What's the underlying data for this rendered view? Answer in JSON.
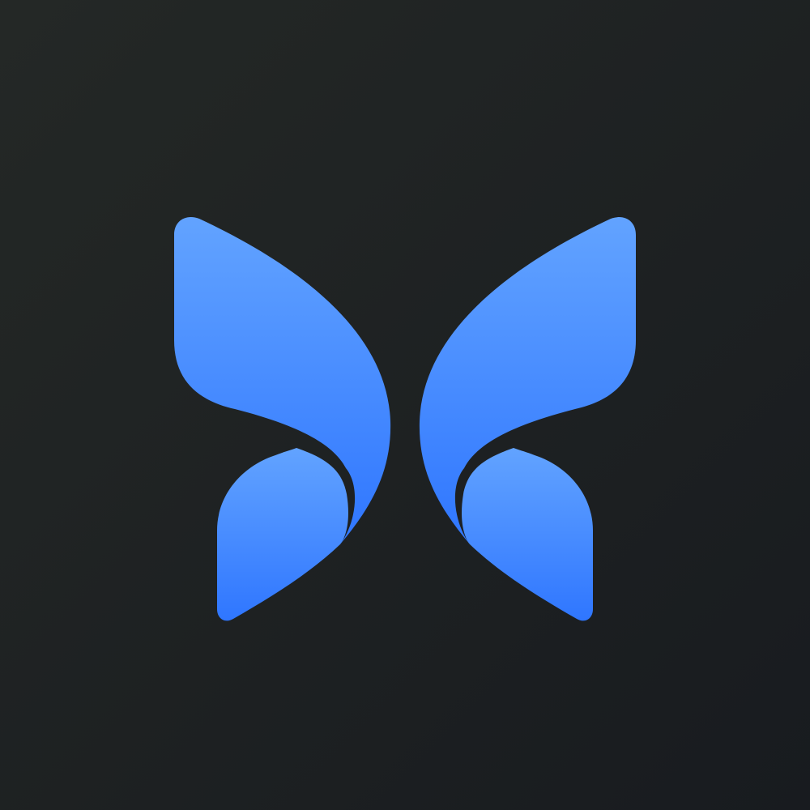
{
  "logo": {
    "icon": "butterfly-icon",
    "colors": {
      "background_top_left": "#242826",
      "background_bottom_right": "#181b1f",
      "wing_light": "#62a3ff",
      "wing_dark": "#2f76ff"
    }
  }
}
